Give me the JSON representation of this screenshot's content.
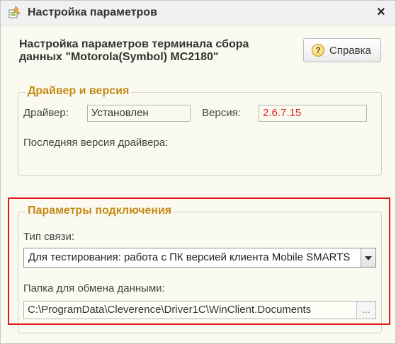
{
  "window": {
    "title": "Настройка параметров",
    "close_glyph": "×"
  },
  "header": {
    "description": "Настройка параметров терминала сбора данных \"Motorola(Symbol) MC2180\"",
    "help_button_label": "Справка",
    "help_icon": "?"
  },
  "driver_group": {
    "title": "Драйвер и версия",
    "driver_label": "Драйвер:",
    "driver_value": "Установлен",
    "version_label": "Версия:",
    "version_value": "2.6.7.15",
    "version_color": "#e0241e",
    "latest_version_label": "Последняя версия драйвера:"
  },
  "connection_group": {
    "title": "Параметры подключения",
    "connection_type_label": "Тип связи:",
    "connection_type_value": "Для тестирования: работа с ПК версией клиента Mobile SMARTS",
    "exchange_folder_label": "Папка для обмена данными:",
    "exchange_folder_value": "C:\\ProgramData\\Cleverence\\Driver1C\\WinClient.Documents",
    "select_button_label": "..."
  },
  "colors": {
    "group_title": "#c48a16",
    "highlight_border": "#e2151b",
    "background": "#fbfaf0"
  }
}
